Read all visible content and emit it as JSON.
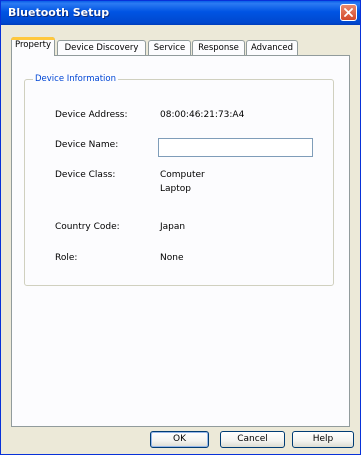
{
  "window": {
    "title": "Bluetooth Setup"
  },
  "tabs": [
    {
      "label": "Property",
      "active": true
    },
    {
      "label": "Device Discovery",
      "active": false
    },
    {
      "label": "Service",
      "active": false
    },
    {
      "label": "Response",
      "active": false
    },
    {
      "label": "Advanced",
      "active": false
    }
  ],
  "device_info": {
    "group_title": "Device Information",
    "address_label": "Device Address:",
    "address_value": "08:00:46:21:73:A4",
    "name_label": "Device Name:",
    "name_value": "",
    "class_label": "Device Class:",
    "class_value_1": "Computer",
    "class_value_2": "Laptop",
    "country_label": "Country Code:",
    "country_value": "Japan",
    "role_label": "Role:",
    "role_value": "None"
  },
  "buttons": {
    "ok": "OK",
    "cancel": "Cancel",
    "help": "Help"
  },
  "colors": {
    "titlebar": "#0054e3",
    "group_title": "#0046d5",
    "close_button": "#d4492a",
    "active_tab_accent": "#ffc83c"
  },
  "icons": {
    "close": "close-icon"
  }
}
